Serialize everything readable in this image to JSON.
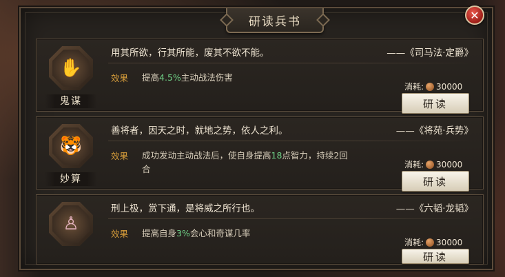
{
  "title": "研读兵书",
  "close_icon": "close-icon",
  "cards": [
    {
      "emblem_name": "鬼谋",
      "emblem_icon": "raised-hand-icon",
      "quote": "用其所欲，行其所能，废其不欲不能。",
      "source": "——《司马法·定爵》",
      "effect_tag": "效果",
      "effect_pre": "提高",
      "effect_highlight": "4.5%",
      "effect_post": "主动战法伤害",
      "cost_label": "消耗:",
      "cost_value": "30000",
      "button_label": "研读"
    },
    {
      "emblem_name": "妙算",
      "emblem_icon": "tiger-statue-icon",
      "quote": "善将者，因天之时，就地之势，依人之利。",
      "source": "——《将苑·兵势》",
      "effect_tag": "效果",
      "effect_pre": "成功发动主动战法后，使自身提高",
      "effect_highlight": "18",
      "effect_post": "点智力，持续2回合",
      "cost_label": "消耗:",
      "cost_value": "30000",
      "button_label": "研读"
    },
    {
      "emblem_name": "",
      "emblem_icon": "robed-figure-icon",
      "quote": "刑上极，赏下通，是将威之所行也。",
      "source": "——《六韬·龙韬》",
      "effect_tag": "效果",
      "effect_pre": "提高自身",
      "effect_highlight": "3%",
      "effect_post": "会心和奇谋几率",
      "cost_label": "消耗:",
      "cost_value": "30000",
      "button_label": "研读"
    }
  ],
  "colors": {
    "effect_tag": "#d39a3a",
    "highlight": "#6fcf86",
    "close_button": "#c0392b"
  }
}
